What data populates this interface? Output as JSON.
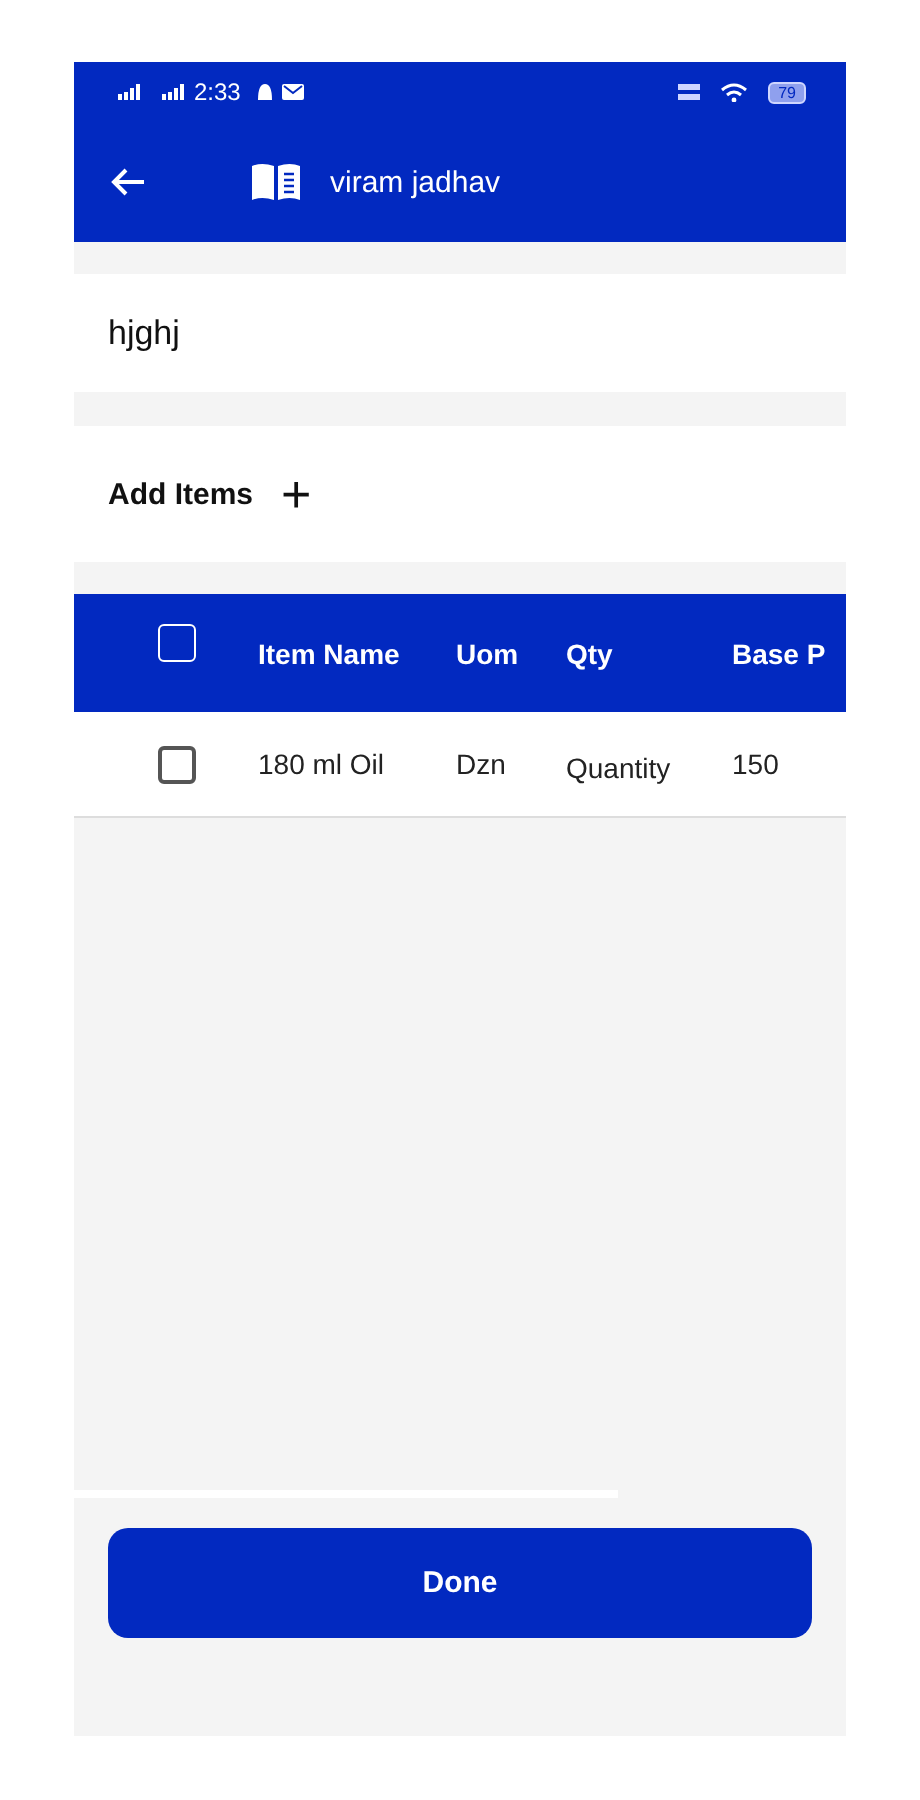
{
  "status_bar": {
    "time": "2:33",
    "battery": "79"
  },
  "app_bar": {
    "title": "viram jadhav"
  },
  "name_field": {
    "value": "hjghj"
  },
  "add_items": {
    "label": "Add Items",
    "icon": "+"
  },
  "table": {
    "header_checked": false,
    "columns": [
      "Item Name",
      "Uom",
      "Qty",
      "Base P"
    ],
    "rows": [
      {
        "checked": false,
        "cells": [
          "180 ml Oil",
          "Dzn",
          "Quantity",
          "150"
        ]
      }
    ]
  },
  "done_button": "Done"
}
